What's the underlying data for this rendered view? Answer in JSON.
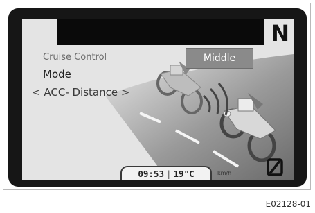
{
  "display": {
    "gear": "N",
    "menu": {
      "title": "Cruise Control",
      "item": "Mode",
      "sub_left_arrow": "<",
      "sub_label": "ACC- Distance",
      "sub_right_arrow": ">"
    },
    "value": "Middle",
    "status": {
      "time": "09:53",
      "separator": "|",
      "temperature": "19°C",
      "speed_unit": "km/h"
    }
  },
  "caption": "E02128-01",
  "icons": [
    "road-illustration-icon",
    "motorcycle-icon",
    "distance-signal-icon",
    "zero-slash-icon"
  ],
  "colors": {
    "screen": "#e4e4e4",
    "bezel": "#161616",
    "value_box": "#8a8a8a"
  }
}
